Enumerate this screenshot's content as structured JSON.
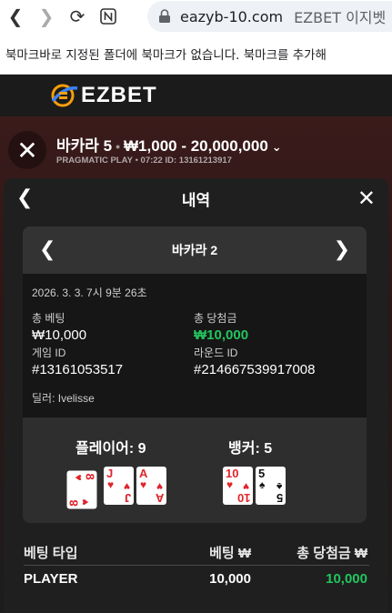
{
  "browser": {
    "url": "eazyb-10.com",
    "site_title": "EZBET 이지벳",
    "bookmark_notice": "북마크바로 지정된 폴더에 북마크가 없습니다. 북마크를 추가해"
  },
  "site": {
    "logo_text": "EZBET"
  },
  "game": {
    "title": "바카라 5",
    "limits": "₩1,000 - 20,000,000",
    "provider": "PRAGMATIC PLAY",
    "time": "07:22",
    "id_label": "ID: 13161213917"
  },
  "history": {
    "title": "내역",
    "game_name": "바카라 2",
    "timestamp": "2026. 3. 3. 7시 9분 26초",
    "total_bet_label": "총 베팅",
    "total_bet_value": "₩10,000",
    "total_win_label": "총 당첨금",
    "total_win_value": "₩10,000",
    "game_id_label": "게임 ID",
    "game_id_value": "#13161053517",
    "round_id_label": "라운드 ID",
    "round_id_value": "#214667539917008",
    "dealer": "딜러: Ivelisse",
    "player_label": "플레이어: 9",
    "banker_label": "뱅커: 5",
    "player_cards": [
      {
        "rank": "8",
        "suit": "♥",
        "color": "red",
        "rotated": true
      },
      {
        "rank": "J",
        "suit": "♥",
        "color": "red",
        "rotated": false
      },
      {
        "rank": "A",
        "suit": "♥",
        "color": "red",
        "rotated": false
      }
    ],
    "banker_cards": [
      {
        "rank": "10",
        "suit": "♥",
        "color": "red",
        "rotated": false
      },
      {
        "rank": "5",
        "suit": "♠",
        "color": "black",
        "rotated": false
      }
    ],
    "table": {
      "col_type": "베팅 타입",
      "col_bet": "베팅 ₩",
      "col_win": "총 당첨금 ₩",
      "rows": [
        {
          "type": "PLAYER",
          "bet": "10,000",
          "win": "10,000"
        }
      ]
    }
  },
  "colors": {
    "win_green": "#22c55e",
    "panel_bg": "#1f1f1f"
  }
}
